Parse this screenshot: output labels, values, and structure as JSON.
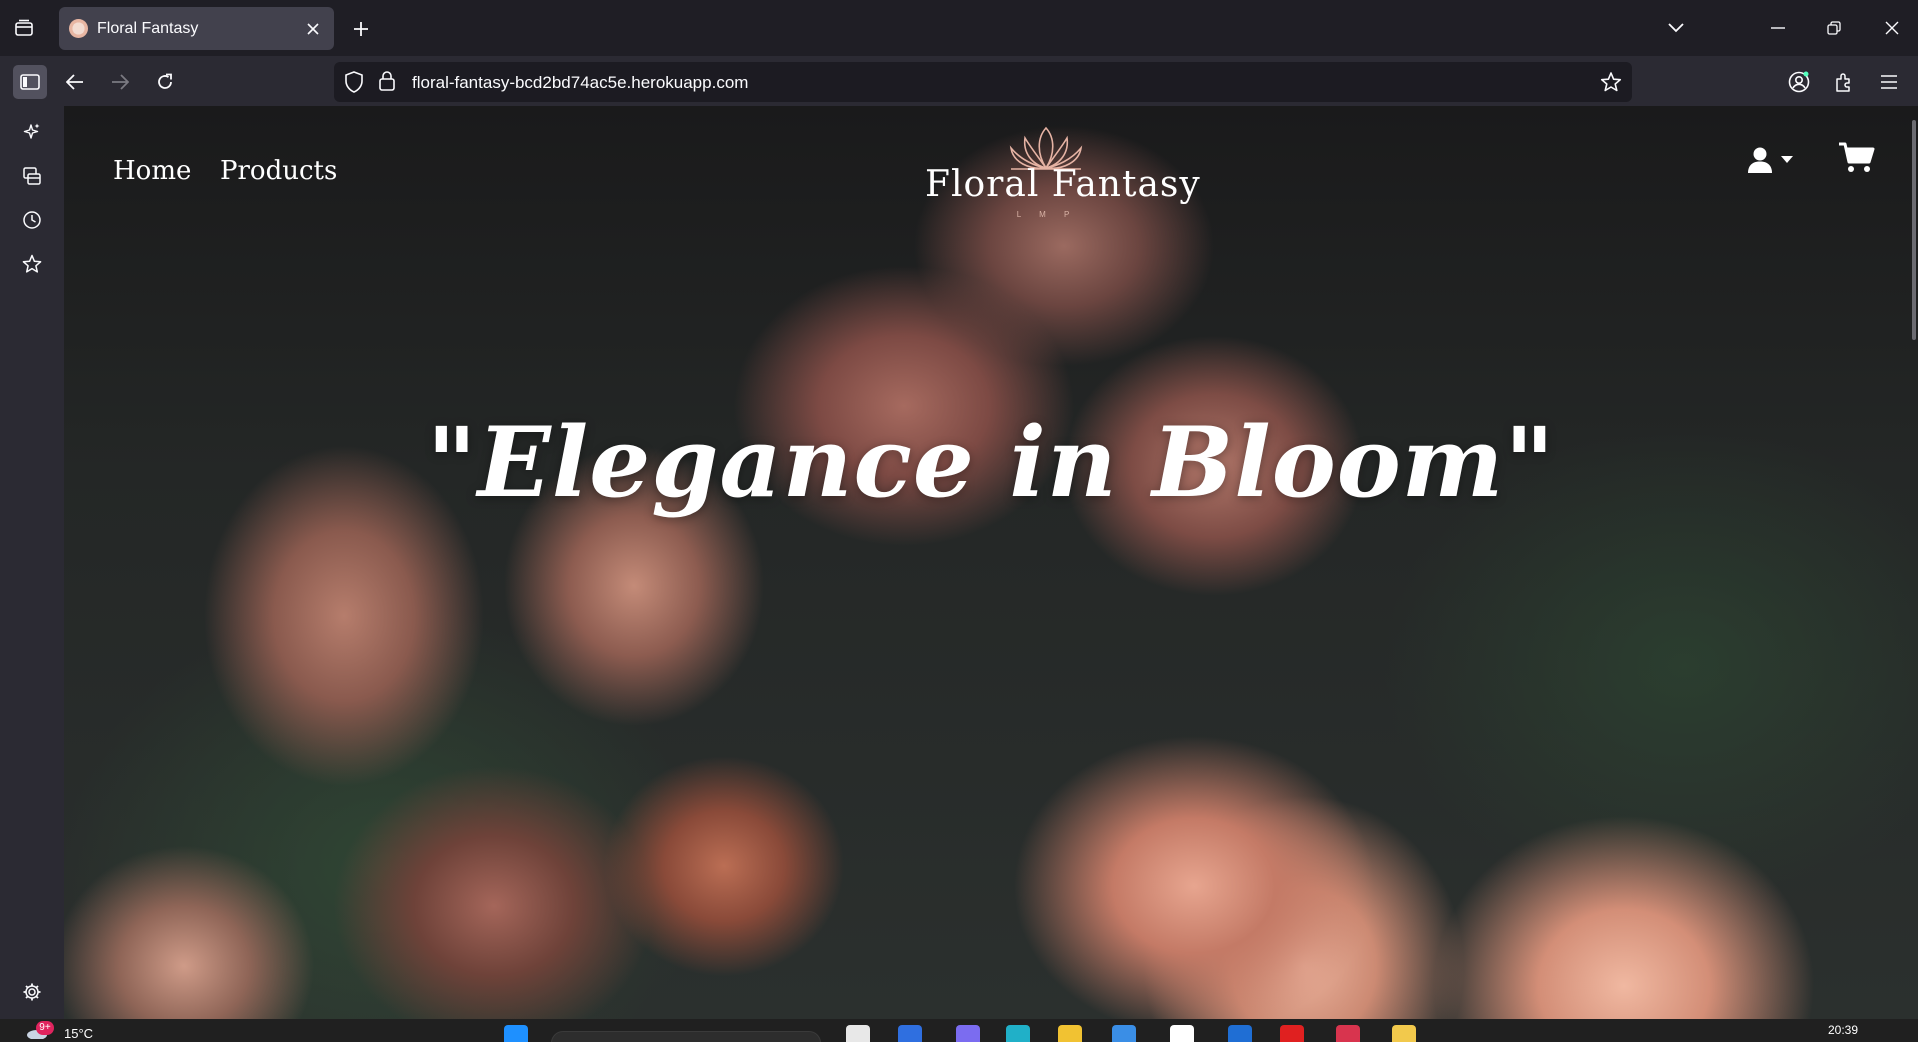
{
  "browser": {
    "tab_title": "Floral Fantasy",
    "url": "floral-fantasy-bcd2bd74ac5e.herokuapp.com"
  },
  "site": {
    "nav": [
      {
        "label": "Home"
      },
      {
        "label": "Products"
      }
    ],
    "logo": {
      "name": "Floral Fantasy",
      "sub": "L M P"
    },
    "tagline": "\"Elegance in Bloom\"",
    "icons": [
      "user-icon",
      "caret-down-icon",
      "cart-icon"
    ]
  },
  "taskbar": {
    "weather_temp": "15°C",
    "notification_badge": "9+",
    "clock": "20:39"
  },
  "colors": {
    "accent": "#e7a58f",
    "chrome_dark": "#1c1b22",
    "chrome_mid": "#2b2a33"
  }
}
